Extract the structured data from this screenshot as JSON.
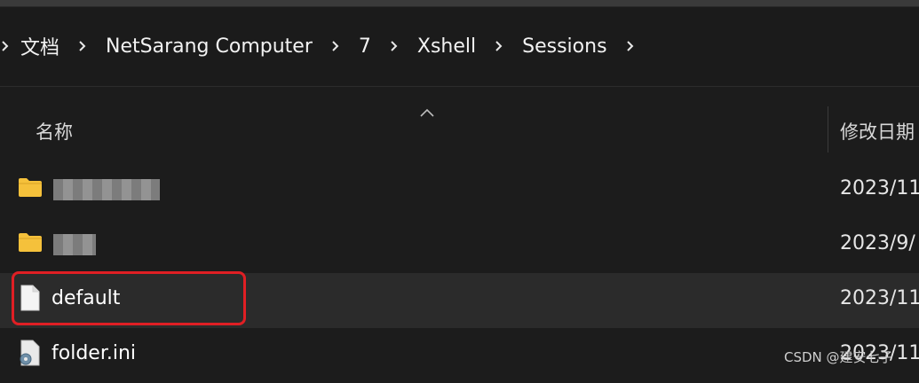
{
  "breadcrumb": {
    "items": [
      "文档",
      "NetSarang Computer",
      "7",
      "Xshell",
      "Sessions"
    ]
  },
  "columns": {
    "name_header": "名称",
    "date_header": "修改日期"
  },
  "files": [
    {
      "name": "",
      "type": "folder",
      "icon": "folder-icon",
      "date": "2023/11",
      "obscured": true
    },
    {
      "name": "",
      "type": "folder",
      "icon": "folder-icon",
      "date": "2023/9/",
      "obscured": true
    },
    {
      "name": "default",
      "type": "file",
      "icon": "file-icon",
      "date": "2023/11",
      "obscured": false
    },
    {
      "name": "folder.ini",
      "type": "settings",
      "icon": "settings-file-icon",
      "date": "2023/11",
      "obscured": false
    }
  ],
  "watermark": "CSDN @建安七子",
  "colors": {
    "background": "#1c1c1c",
    "folder": "#f5c13b",
    "highlight": "#e01f24"
  }
}
